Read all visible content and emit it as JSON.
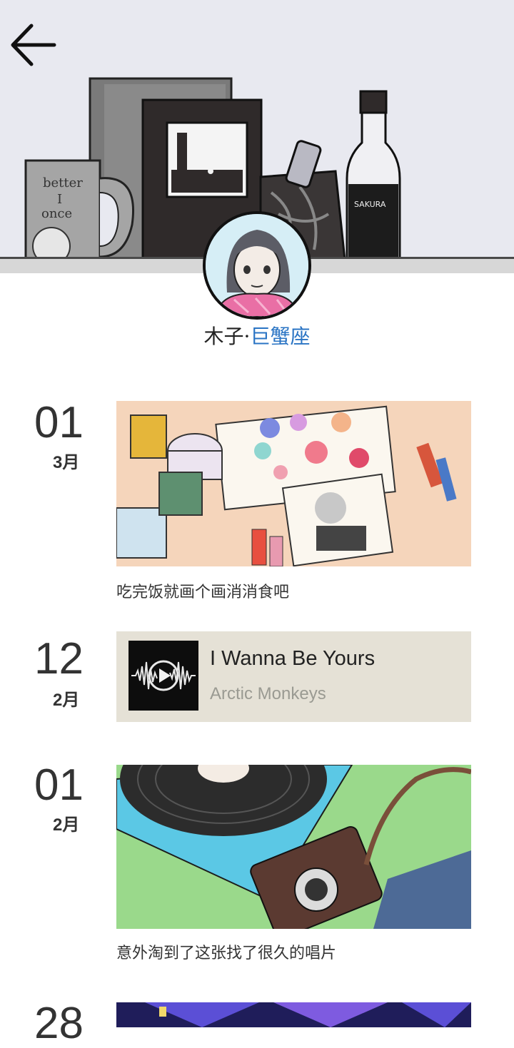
{
  "profile": {
    "name": "木子",
    "separator": "·",
    "sign": "巨蟹座"
  },
  "icons": {
    "back": "arrow-left-icon",
    "play": "play-icon"
  },
  "timeline": [
    {
      "day": "01",
      "month": "3月",
      "type": "image",
      "caption": "吃完饭就画个画消消食吧"
    },
    {
      "day": "12",
      "month": "2月",
      "type": "music",
      "title": "I Wanna Be Yours",
      "artist": "Arctic Monkeys"
    },
    {
      "day": "01",
      "month": "2月",
      "type": "image",
      "caption": "意外淘到了这张找了很久的唱片"
    },
    {
      "day": "28",
      "month": "",
      "type": "image",
      "caption": ""
    }
  ],
  "colors": {
    "header_bg": "#e8e9f0",
    "sign_blue": "#2a74c4",
    "music_card_bg": "#e5e1d6"
  }
}
